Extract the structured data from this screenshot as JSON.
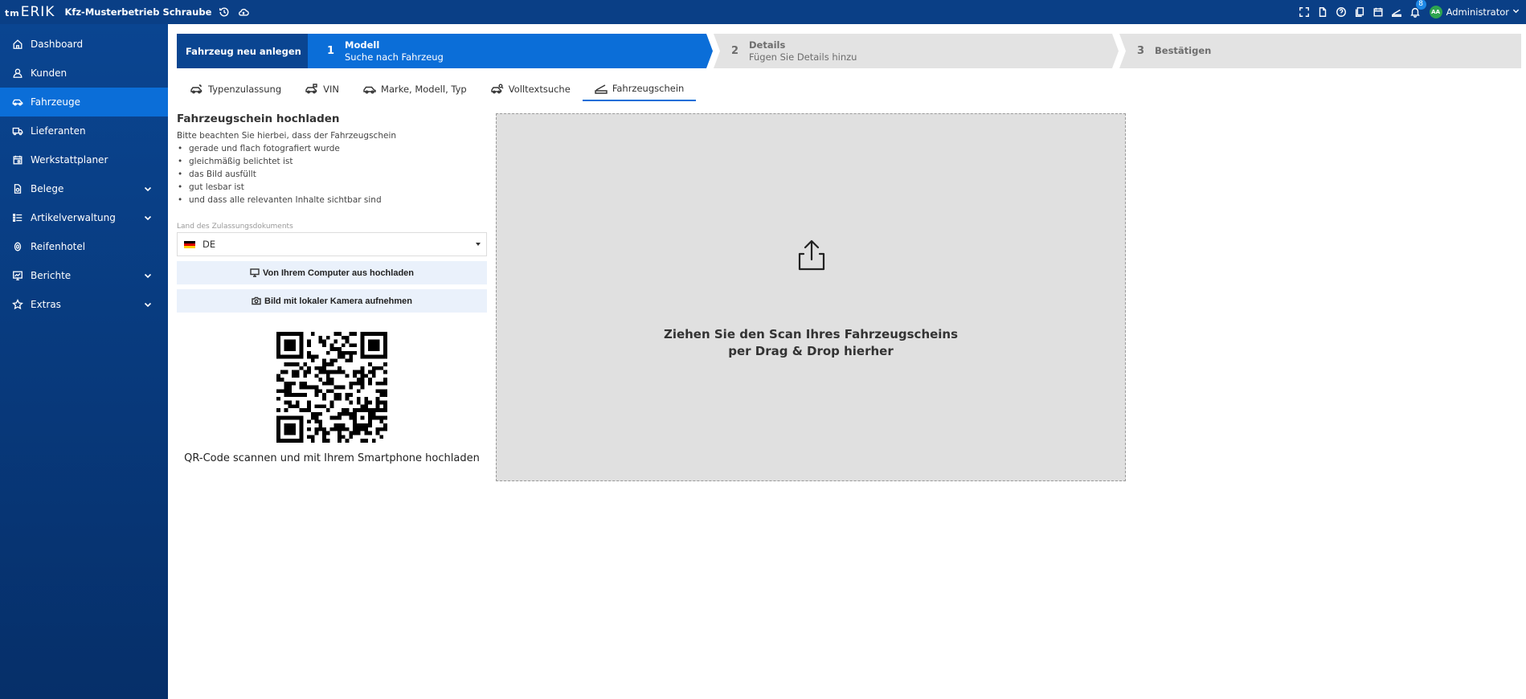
{
  "header": {
    "logo_small": "tm",
    "logo_big": "ERIK",
    "company": "Kfz-Musterbetrieb Schraube",
    "notifications_count": "8",
    "avatar_initials": "AA",
    "user_name": "Administrator"
  },
  "sidebar": {
    "items": [
      {
        "label": "Dashboard",
        "icon": "home-icon"
      },
      {
        "label": "Kunden",
        "icon": "user-icon"
      },
      {
        "label": "Fahrzeuge",
        "icon": "car-icon"
      },
      {
        "label": "Lieferanten",
        "icon": "truck-icon"
      },
      {
        "label": "Werkstattplaner",
        "icon": "calendar-icon"
      },
      {
        "label": "Belege",
        "icon": "document-icon"
      },
      {
        "label": "Artikelverwaltung",
        "icon": "list-icon"
      },
      {
        "label": "Reifenhotel",
        "icon": "tire-icon"
      },
      {
        "label": "Berichte",
        "icon": "report-icon"
      },
      {
        "label": "Extras",
        "icon": "star-icon"
      }
    ]
  },
  "stepper": {
    "title": "Fahrzeug neu anlegen",
    "steps": [
      {
        "num": "1",
        "label": "Modell",
        "sub": "Suche nach Fahrzeug"
      },
      {
        "num": "2",
        "label": "Details",
        "sub": "Fügen Sie Details hinzu"
      },
      {
        "num": "3",
        "label": "Bestätigen",
        "sub": ""
      }
    ]
  },
  "tabs": [
    {
      "label": "Typenzulassung",
      "icon": "car-key-icon"
    },
    {
      "label": "VIN",
      "icon": "car-tag-icon"
    },
    {
      "label": "Marke, Modell, Typ",
      "icon": "car-icon"
    },
    {
      "label": "Volltextsuche",
      "icon": "car-search-icon"
    },
    {
      "label": "Fahrzeugschein",
      "icon": "scanner-icon"
    }
  ],
  "upload": {
    "title": "Fahrzeugschein hochladen",
    "intro": "Bitte beachten Sie hierbei, dass der Fahrzeugschein",
    "hints": [
      "gerade und flach fotografiert wurde",
      "gleichmäßig belichtet ist",
      "das Bild ausfüllt",
      "gut lesbar ist",
      "und dass alle relevanten Inhalte sichtbar sind"
    ],
    "country_label": "Land des Zulassungsdokuments",
    "country_value": "DE",
    "btn_computer": "Von Ihrem Computer aus hochladen",
    "btn_camera": "Bild mit lokaler Kamera aufnehmen",
    "qr_caption": "QR-Code scannen und mit Ihrem Smartphone hochladen"
  },
  "dropzone": {
    "line1": "Ziehen Sie den Scan Ihres Fahrzeugscheins",
    "line2": "per Drag & Drop hierher"
  },
  "colors": {
    "topbar": "#0a3f86",
    "accent": "#0b6ed8",
    "step_inactive": "#e3e3e3",
    "dropzone": "#e0e0e0"
  }
}
